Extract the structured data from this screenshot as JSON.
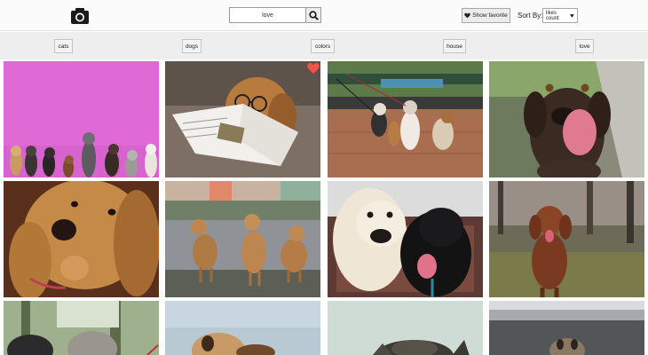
{
  "header": {
    "logo_icon": "camera-icon",
    "search": {
      "value": "love",
      "button_icon": "magnifier-icon"
    },
    "favorite_button": {
      "label": "Show favorite",
      "icon": "heart-icon"
    },
    "sort": {
      "label": "Sort By:",
      "selected": "likes count",
      "caret_icon": "caret-down-icon"
    }
  },
  "tags": [
    "cats",
    "dogs",
    "colors",
    "house",
    "love"
  ],
  "photos": [
    {
      "subject": "row of small dogs against a pink wall"
    },
    {
      "subject": "dog with glasses reading a magazine",
      "favorited": true,
      "favorite_icon": "heart-icon"
    },
    {
      "subject": "dogs on leashes on a brick plaza"
    },
    {
      "subject": "brown dog licking its nose"
    },
    {
      "subject": "golden dog close-up"
    },
    {
      "subject": "three puppies on a gravel path"
    },
    {
      "subject": "white and black dogs on a rug"
    },
    {
      "subject": "brown dog in a forest"
    },
    {
      "subject": "two dogs among trees"
    },
    {
      "subject": "dog against a pale sky"
    },
    {
      "subject": "dog head peeking up"
    },
    {
      "subject": "dog on a road"
    }
  ],
  "colors": {
    "header_bg": "#fbfbfb",
    "tagbar_bg": "#eeeeee",
    "favorite_heart": "#f0554a"
  }
}
